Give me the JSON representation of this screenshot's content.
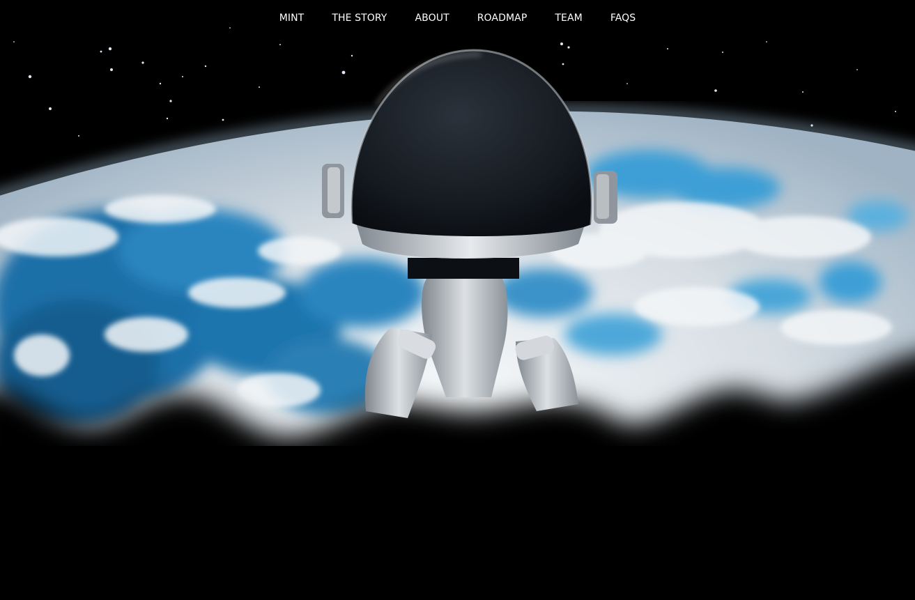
{
  "nav": {
    "items": [
      {
        "label": "MINT"
      },
      {
        "label": "THE STORY"
      },
      {
        "label": "ABOUT"
      },
      {
        "label": "ROADMAP"
      },
      {
        "label": "TEAM"
      },
      {
        "label": "FAQS"
      }
    ]
  },
  "hero": {
    "scene_icons": [
      "earth-icon",
      "astronaut-robot-icon",
      "star-icon"
    ],
    "colors": {
      "space": "#000000",
      "ocean": "#1b6fa8",
      "ocean_light": "#3d9fd6",
      "clouds": "#e9eef2",
      "helmet_dark": "#1a1f26",
      "suit": "#c9ced3"
    }
  }
}
